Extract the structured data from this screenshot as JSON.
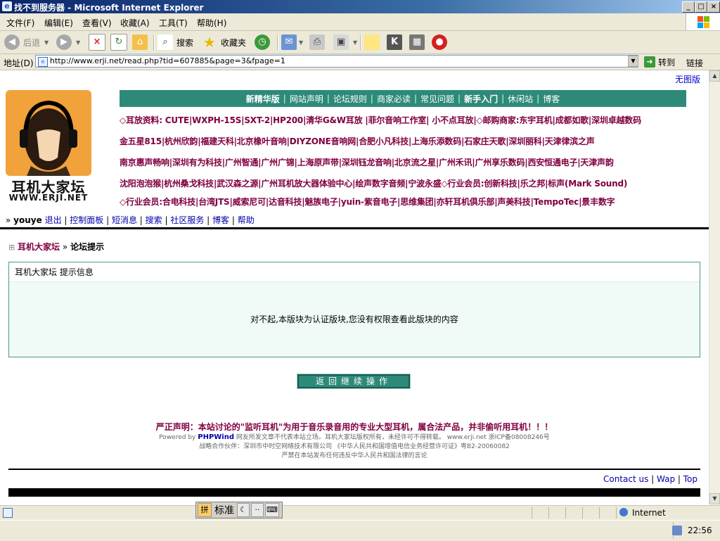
{
  "window": {
    "title": "找不到服务器 - Microsoft Internet Explorer",
    "btn_min": "_",
    "btn_max": "□",
    "btn_close": "×"
  },
  "menu": [
    "文件(F)",
    "编辑(E)",
    "查看(V)",
    "收藏(A)",
    "工具(T)",
    "帮助(H)"
  ],
  "toolbar": {
    "back": "后退",
    "search": "搜索",
    "favorites": "收藏夹"
  },
  "address": {
    "label": "地址(D)",
    "url": "http://www.erji.net/read.php?tid=607885&page=3&fpage=1",
    "go": "转到",
    "links": "链接"
  },
  "page": {
    "no_image": "无图版",
    "logo_text_cn": "耳机大家坛",
    "logo_text_en": "WWW.ERJI.NET",
    "nav": [
      "新精华版",
      "网站声明",
      "论坛规则",
      "商家必读",
      "常见问题",
      "新手入门",
      "休闲站",
      "博客"
    ],
    "ad_rows": [
      "◇耳放资料: CUTE|WXPH-15S|SXT-2|HP200|清华G&W耳放 |菲尔音响工作室| 小不点耳放|◇邮购商家:东宇耳机|成都如歌|深圳卓越数码",
      "金五星815|杭州欣韵|福建天科|北京橡叶音响|DIYZONE音响网|合肥小凡科技|上海乐添数码|石家庄天歌|深圳丽科|天津律滨之声",
      "南京惠声畅响|深圳有为科技|广州智通|广州广锦|上海原声带|深圳钰龙音响|北京流之星|广州禾讯|广州享乐数码|西安恒通电子|天津声韵",
      "沈阳泡泡猴|杭州桑戈科技|武汉森之源|广州耳机放大器体验中心|绘声数字音频|宁波永盛◇行业会员:创新科技|乐之邦|标声(Mark Sound)",
      "◇行业会员:合电科技|台湾JTS|威索尼可|达音科技|魅族电子|yuin-紫音电子|思维集团|亦轩耳机俱乐部|声美科技|TempoTec|景丰数字"
    ],
    "user": {
      "prefix": "»",
      "name": "youye",
      "links": [
        "退出",
        "控制面板",
        "短消息",
        "搜索",
        "社区服务",
        "博客",
        "帮助"
      ]
    },
    "breadcrumb": {
      "home": "耳机大家坛",
      "sep": "»",
      "current": "论坛提示"
    },
    "prompt": {
      "header": "耳机大家坛 提示信息",
      "message": "对不起,本版块为认证版块,您没有权限查看此版块的内容"
    },
    "return_button": "返回继续操作",
    "footer": {
      "statement": "严正声明：本站讨论的\"监听耳机\"为用于音乐录音用的专业大型耳机，属合法产品，并非偷听用耳机！！！",
      "powered_prefix": "Powered by",
      "powered_name": "PHPWind",
      "powered_rest": "网友所发文章不代表本站立场。耳机大家坛版权所有，未经许可不得转载。 www.erji.net 浙ICP备08008246号",
      "partner": "战略合作伙伴：深圳市中时空网络技术有限公司 《中华人民共和国增值电信业务经营许可证》粤B2-20060082",
      "warning": "严禁在本站发布任何违反中华人民共和国法律的言论",
      "links": [
        "Contact us",
        "Wap",
        "Top"
      ]
    }
  },
  "status": {
    "zone": "Internet",
    "time": "22:56",
    "ime_mode": "标准"
  }
}
